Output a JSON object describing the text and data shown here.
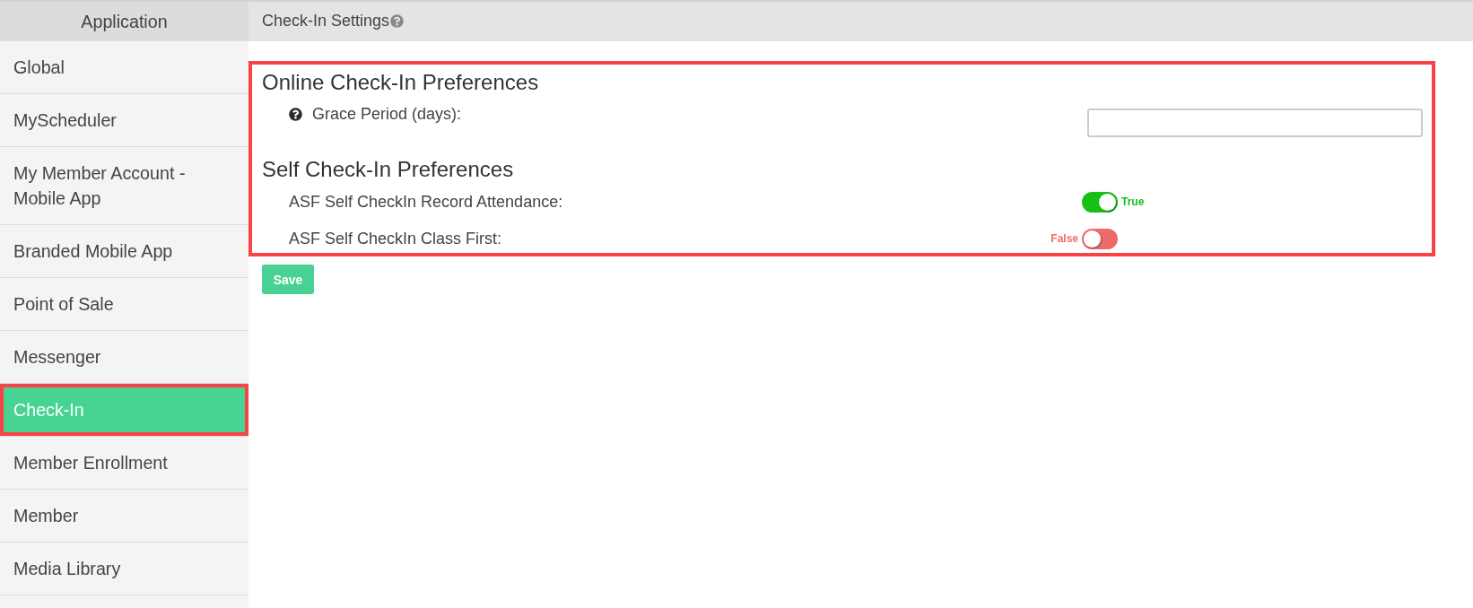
{
  "sidebar": {
    "title": "Application",
    "items": [
      {
        "label": "Global",
        "selected": false,
        "annotated": false
      },
      {
        "label": "MyScheduler",
        "selected": false,
        "annotated": false
      },
      {
        "label": "My Member Account - Mobile App",
        "selected": false,
        "annotated": false
      },
      {
        "label": "Branded Mobile App",
        "selected": false,
        "annotated": false
      },
      {
        "label": "Point of Sale",
        "selected": false,
        "annotated": false
      },
      {
        "label": "Messenger",
        "selected": false,
        "annotated": false
      },
      {
        "label": "Check-In",
        "selected": true,
        "annotated": true
      },
      {
        "label": "Member Enrollment",
        "selected": false,
        "annotated": false
      },
      {
        "label": "Member",
        "selected": false,
        "annotated": false
      },
      {
        "label": "Media Library",
        "selected": false,
        "annotated": false
      }
    ]
  },
  "header": {
    "title": "Check-In Settings",
    "help": true
  },
  "panel": {
    "annotated": true,
    "sections": [
      {
        "heading": "Online Check-In Preferences",
        "fields": [
          {
            "kind": "text",
            "label": "Grace Period (days):",
            "help": true
          }
        ]
      },
      {
        "heading": "Self Check-In Preferences",
        "fields": [
          {
            "kind": "toggle",
            "label": "ASF Self CheckIn Record Attendance:",
            "help": false,
            "on": true,
            "state_label": "True"
          },
          {
            "kind": "toggle",
            "label": "ASF Self CheckIn Class First:",
            "help": false,
            "on": false,
            "state_label": "False"
          }
        ]
      }
    ]
  },
  "save_button": "Save"
}
